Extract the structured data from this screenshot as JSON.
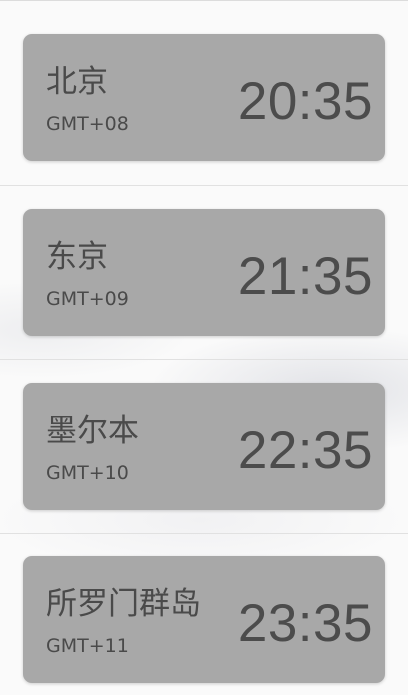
{
  "world_clock": {
    "items": [
      {
        "city": "北京",
        "timezone": "GMT+08",
        "time": "20:35"
      },
      {
        "city": "东京",
        "timezone": "GMT+09",
        "time": "21:35"
      },
      {
        "city": "墨尔本",
        "timezone": "GMT+10",
        "time": "22:35"
      },
      {
        "city": "所罗门群岛",
        "timezone": "GMT+11",
        "time": "23:35"
      }
    ]
  }
}
